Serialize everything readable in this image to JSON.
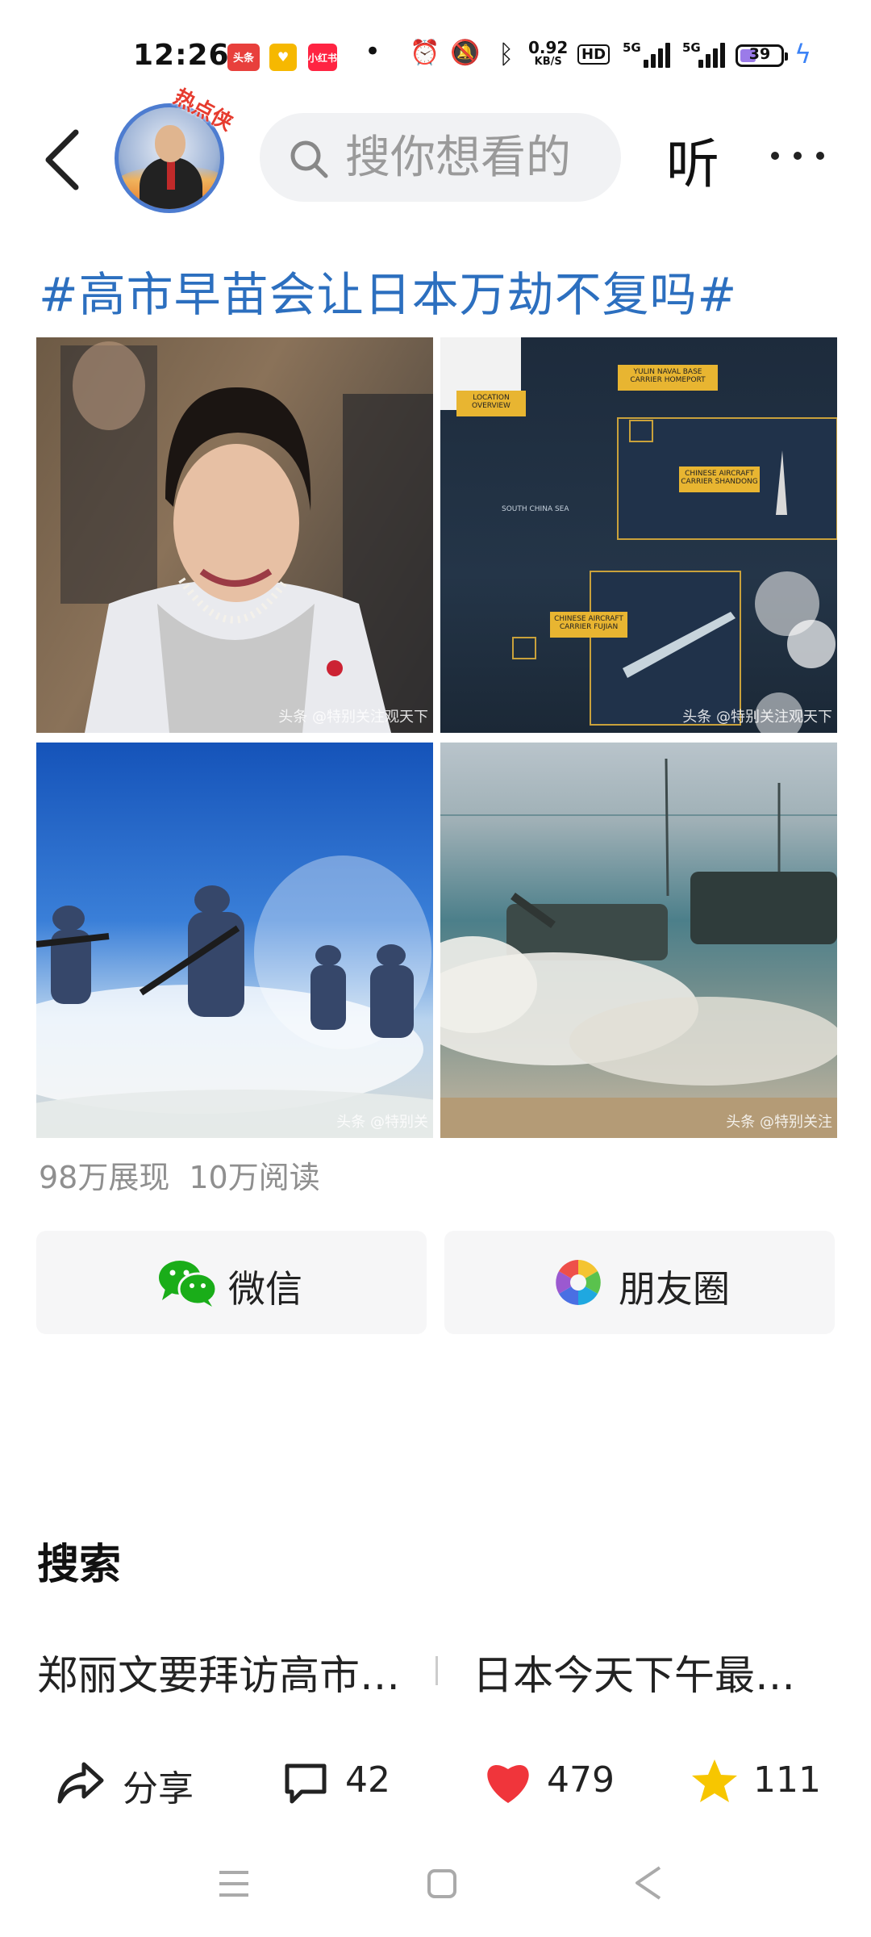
{
  "status_bar": {
    "time": "12:26",
    "apps": [
      "头条",
      "",
      "小红书"
    ],
    "net_speed_value": "0.92",
    "net_speed_unit": "KB/S",
    "hd": "HD",
    "sig1": "5G",
    "sig2": "5G",
    "battery": "39",
    "battery_level": 39,
    "icons": [
      "dot-icon",
      "alarm-icon",
      "mute-icon",
      "bluetooth-icon",
      "charging-icon"
    ]
  },
  "nav": {
    "avatar_tag": "热点侠",
    "search_placeholder": "搜你想看的",
    "listen_label": "听"
  },
  "post": {
    "hashtag": "#高市早苗会让日本万劫不复吗#",
    "images": [
      {
        "watermark": "头条 @特别关注观天下"
      },
      {
        "watermark": "头条 @特别关注观天下",
        "labels": [
          "LOCATION OVERVIEW",
          "YULIN NAVAL BASE CARRIER HOMEPORT",
          "CHINESE AIRCRAFT CARRIER SHANDONG",
          "SOUTH CHINA SEA",
          "CHINESE AIRCRAFT CARRIER FUJIAN"
        ]
      },
      {
        "watermark": "头条 @特别关"
      },
      {
        "watermark": "头条 @特别关注"
      }
    ],
    "impressions": "98万展现",
    "reads": "10万阅读"
  },
  "share": {
    "wechat": "微信",
    "moments": "朋友圈"
  },
  "search_section": {
    "title": "搜索",
    "suggestions": [
      "郑丽文要拜访高市…",
      "日本今天下午最…"
    ]
  },
  "actions": {
    "share": "分享",
    "comments": "42",
    "likes": "479",
    "favorites": "111"
  },
  "colors": {
    "hashtag": "#2c6fbf",
    "like": "#f0353b",
    "favorite": "#f7c600",
    "wechat": "#1aad19"
  }
}
